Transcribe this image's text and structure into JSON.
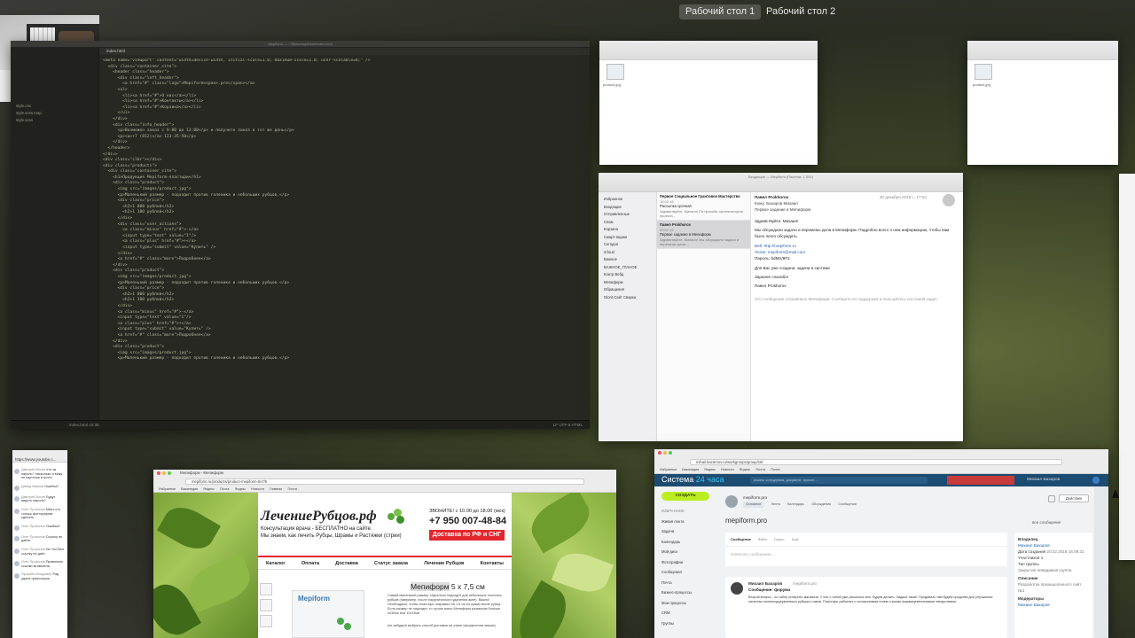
{
  "desktops": {
    "tab1": "Рабочий стол 1",
    "tab2": "Рабочий стол 2"
  },
  "editor": {
    "title": "Mepiform — ~/Sites/mepiform/index.html",
    "tabs": [
      "index.html"
    ],
    "files": [
      "style.css",
      "style.scss.map",
      "style.scss"
    ],
    "status_left": "index.html   10:36",
    "status_right": "LF   UTF-8   HTML",
    "code": [
      "<meta name=\"viewport\" content=\"width=device-width, initial-scale=1.0; maximum-scale=1.0; user-scalable=0;\" />",
      "",
      "",
      "  <div class=\"container_site\">",
      "    <header class=\"header\">",
      "      <div class=\"left_header\">",
      "        <a href=\"#\" class=\"logo\">Mepiform<span>.pro</span></a>",
      "      <ul>",
      "        <li><a href=\"#\">О нас</a></li>",
      "        <li><a href=\"#\">Контакты</a></li>",
      "        <li><a href=\"#\">Корзина</a></li>",
      "      </ul>",
      "    </div>",
      "    <div class=\"info_header\">",
      "      <p>Возможен заказ с 9:00 до 13:00</p> и получите заказ в тот же день</p>",
      "      <p><a>+7 (812)</a> 123-35-50</p>",
      "    </div>",
      "  </header>",
      "</div>",
      "<div class=\"clbr\"></div>",
      "",
      "",
      "<div class=\"products\">",
      "  <div class=\"container_site\">",
      "    <h1>Продукция Mepiform-пластыри</h1>",
      "    <div class=\"product\">",
      "      <img src=\"images/product.jpg\">",
      "      <p>Маленький размер - подходит против голеника и небольших рубцов.</p>",
      "      <div class=\"price\">",
      "        <h2>1 000 рублей</h2>",
      "        <h2>1 100 рублей</h2>",
      "      </div>",
      "      <div class=\"user_actions\">",
      "        <a class=\"minus\" href=\"#\">-</a>",
      "        <input type=\"text\" value=\"1\"/>",
      "        <a class=\"plus\" href=\"#\">+</a>",
      "        <input type=\"submit\" value=\"Купить\" />",
      "      </div>",
      "      <a href=\"#\" class=\"more\">Подробнее</a>",
      "    </div>",
      "",
      "    <div class=\"product\">",
      "      <img src=\"images/product.jpg\">",
      "      <p>Маленький размер - подходит против голеника и небольших рубцов.</p>",
      "      <div class=\"price\">",
      "        <h2>1 000 рублей</h2>",
      "        <h2>1 100 рублей</h2>",
      "      </div>",
      "      <a class=\"minus\" href=\"#\">-</a>",
      "      <input type=\"text\" value=\"1\"/>",
      "      <a class=\"plus\" href=\"#\">+</a>",
      "      <input type=\"submit\" value=\"Купить\" />",
      "      <a href=\"#\" class=\"more\">Подробнее</a>",
      "    </div>",
      "",
      "    <div class=\"product\">",
      "      <img src=\"images/product.jpg\">",
      "      <p>Маленький размер - подходит против голеника и небольших рубцов.</p>"
    ]
  },
  "finder1": {
    "file_label": "product.jpg"
  },
  "finder2": {
    "file_label": "product.jpg",
    "title": "Images"
  },
  "mail": {
    "title": "Входящие — Mepiform (Пакетов: 1 000)",
    "sidebar_sections": [
      "Избранное",
      "Входящие",
      "Отправленные",
      "Спам",
      "Корзина",
      "Смарт-ящики",
      "Сегодня",
      "iCloud",
      "Важное",
      "ВАЖНОЕ_ГЛАНОЕ",
      "Контр Вебд",
      "Мепиформ",
      "Обращения",
      "Glorit Сайт Сварка"
    ],
    "list": [
      {
        "from": "Первое Социальное Грантовое Мастерство",
        "time": "18.02.18",
        "subject": "Рассылка срочная",
        "preview": "Здравствуйте, Михаил! По просьбе организаторов проекта…"
      },
      {
        "from": "Павел Prokhorov",
        "time": "09.02.18",
        "subject": "Первое задание в Мепиформ",
        "preview": "Здравствуйте, Михаил! Мы обсуждали задачи и перемены дела…"
      }
    ],
    "message": {
      "from": "Павел Prokhorov",
      "to": "Кому: Бахаров Михаил",
      "subject": "Первое задание в Мепиформ",
      "date": "20 декабря 2016 г., 17:54",
      "greeting": "Здравствуйте, Михаил!",
      "body1": "Мы обсуждали задачи и перемены дела в Мепиформ. Подробно всего о нем информацию, чтобы нам было легко обсуждать.",
      "links": [
        "Веб: http://mepiform.ru",
        "Логин: mepiform@mail.com",
        "Пароль: bd56V8F2"
      ],
      "body2": "Для Вас уже создана: задачи в системе",
      "closing": "Заранее спасибо!",
      "signature": "Павел Prokhorov",
      "footer": "Это сообщение отправлено Мепиформ. Сообщите по поддержка и пользуйтесь системой задач."
    }
  },
  "chat": {
    "url": "https://www.youtube.c...",
    "messages": [
      {
        "name": "Дмитрий Вохин",
        "text": "что за пароль? насколько я вижу не карточка в почте"
      },
      {
        "name": "Давид Иванов",
        "text": "Ошибка?"
      },
      {
        "name": "Дмитрий Вохин",
        "text": "Будут видеть пароль?"
      },
      {
        "name": "Олег Прокопов",
        "text": "Мало кто только фотографию сделать"
      },
      {
        "name": "Олег Прокопов",
        "text": "Ошибка?"
      },
      {
        "name": "Олег Прокопов",
        "text": "Ссылку не дайте"
      },
      {
        "name": "Олег Прокопов",
        "text": "На YouTube ссылку не даёт"
      },
      {
        "name": "Олег Прокопов",
        "text": "Правильно ссылки вставлены"
      },
      {
        "name": "Прораба Владимир",
        "text": "Рад удачи трансляции"
      }
    ]
  },
  "site": {
    "title": "Мепиформ - Мепиформ",
    "url": "mepiform.ru/products/product-mepiform-5x7/5",
    "bookmarks": [
      "Избранное",
      "Википедия",
      "Яндекс",
      "Почта",
      "Яндекс",
      "Новости",
      "Главная",
      "Почта"
    ],
    "logo": "ЛечениеРубцов.рф",
    "tagline": "Консультация врача - БЕСПЛАТНО на сайте.\nМы знаем, как лечить Рубцы, Шрамы и Растяжки (стрии)",
    "hours": "ЗВОНИТЕ! с 10.00 до 18.00 (мск)",
    "phone": "+7 950 007-48-84",
    "delivery": "Доставка по РФ и СНГ",
    "nav": [
      "Каталог",
      "Оплата",
      "Доставка",
      "Статус заказа",
      "Лечение Рубцов",
      "Контакты"
    ],
    "product_brand": "Mepiform",
    "product_title_a": "Мепиформ",
    "product_title_b": " 5 х 7,5 см",
    "desc": "Самый маленький размер. Идеально подходит для небольших точечных рубцов (например, после хирургического удаления акне). Важно! Необходимо, чтобы пластырь покрывал на 1,5 см по краям возле рубца. Если размер не подходит, то лучше взять Мепиформ размером больше 4х30см или 10х18см",
    "note": "(не забудьте выбрать способ доставки на этапе оформления заказа)"
  },
  "crm": {
    "url": "mihail.bazarnov.ru/workgroups/group/18/",
    "bookmarks": [
      "Избранное",
      "Википедия",
      "Яндекс",
      "Новости",
      "Яндекс",
      "Почта",
      "Почта"
    ],
    "brand_a": "Система",
    "brand_b": " 24 часа",
    "search_ph": "искать сотрудника, документ, прочее...",
    "user": "Михаил Бахаров",
    "create_btn": "СОЗДАТЬ",
    "sidebar": [
      "ИЗБРАННОЕ",
      "Живая лента",
      "Задачи",
      "Календарь",
      "Мой диск",
      "Фотографии",
      "Сообщения",
      "Почта",
      "Бизнес-процессы",
      "Мои процессы",
      "CRM",
      "Группы"
    ],
    "group_name": "mepiform.pro",
    "group_sub": [
      "Основное",
      "Лента",
      "Календарь",
      "Обсуждения",
      "Сообщения"
    ],
    "group_title": "mepiform.pro",
    "actions_btn": "Действия",
    "filter": "все сообщения",
    "tabs": [
      "Сообщение",
      "Файл",
      "Опрос",
      "Ещё"
    ],
    "post_placeholder": "Написать сообщение...",
    "post_author": "Михаил Бахаров",
    "post_to": "mepiform.pro",
    "post_title": "Сообщение: форума",
    "post_body": "Второй вопрос - по сайту интернет-магазина. У нас с тобой уже решилось все. Будем делать. Задачи такие: Продавать там будем средства для улучшения качества полноподцервленных рубцов и швов. Пластырь работает с силиконовым гелем и всеми фармацевтическими лекарствами.",
    "side_title1": "Владелец",
    "side_owner": "Михаил Бахаров",
    "side_label2": "Дата создания",
    "side_date": "20.02.2018 16:09:31",
    "side_label3": "Участников",
    "side_count": "1",
    "side_label4": "Тип группы",
    "side_type": "Закрытая невидимая группа",
    "side_title5": "Описание",
    "side_desc": "Разработка промышленного сайт №1",
    "side_title6": "Модераторы",
    "side_mod": "Михаил Бахаров"
  }
}
